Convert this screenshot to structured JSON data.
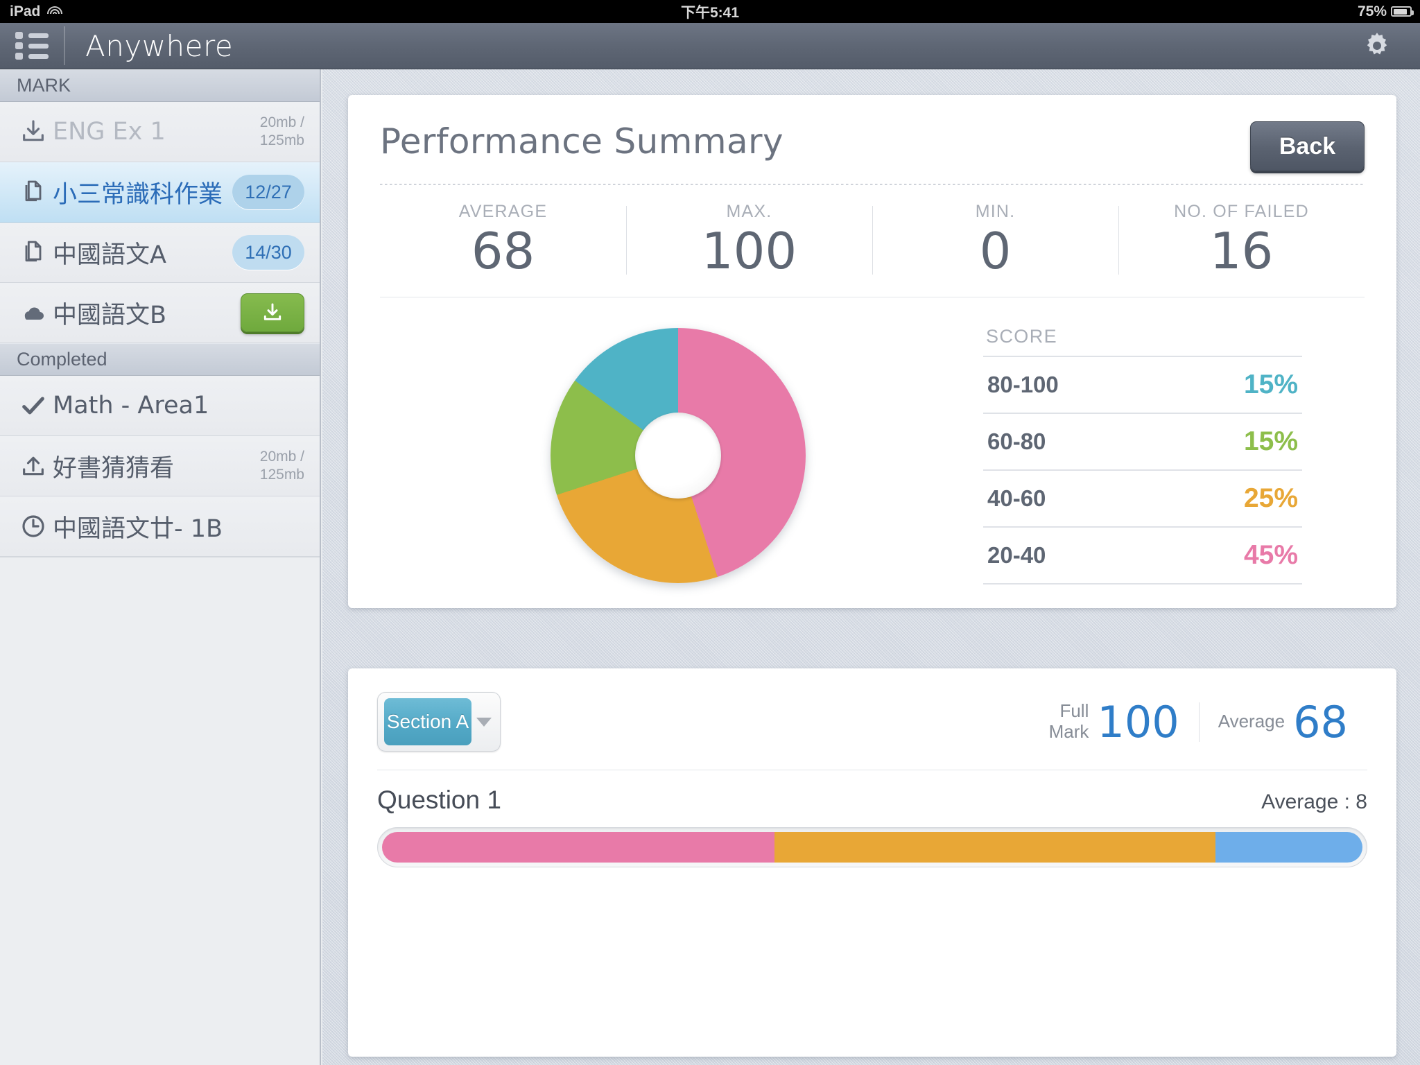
{
  "statusbar": {
    "device": "iPad",
    "wifi_icon": "wifi-icon",
    "time": "下午5:41",
    "battery_pct": "75%",
    "battery_icon": "battery-icon"
  },
  "navbar": {
    "menu_icon": "list-menu-icon",
    "title": "Anywhere",
    "settings_icon": "gear-icon"
  },
  "sidebar": {
    "sections": [
      {
        "header": "MARK",
        "items": [
          {
            "icon": "download-icon",
            "label": "ENG Ex 1",
            "size": "20mb /\n125mb",
            "badge": null,
            "state": "dimmed",
            "action": null
          },
          {
            "icon": "documents-icon",
            "label": "小三常識科作業",
            "size": null,
            "badge": "12/27",
            "state": "selected",
            "action": null
          },
          {
            "icon": "documents-icon",
            "label": "中國語文A",
            "size": null,
            "badge": "14/30",
            "state": "normal",
            "action": null
          },
          {
            "icon": "cloud-icon",
            "label": "中國語文B",
            "size": null,
            "badge": null,
            "state": "normal",
            "action": "download-button"
          }
        ]
      },
      {
        "header": "Completed",
        "items": [
          {
            "icon": "check-icon",
            "label": "Math - Area1",
            "size": null,
            "badge": null,
            "state": "normal",
            "action": null
          },
          {
            "icon": "upload-icon",
            "label": "好書猜猜看",
            "size": "20mb /\n125mb",
            "badge": null,
            "state": "normal",
            "action": null
          },
          {
            "icon": "clock-icon",
            "label": "中國語文廿- 1B",
            "size": null,
            "badge": null,
            "state": "normal",
            "action": null
          }
        ]
      }
    ]
  },
  "summary": {
    "title": "Performance Summary",
    "back_label": "Back",
    "stats": [
      {
        "key": "AVERAGE",
        "value": "68"
      },
      {
        "key": "MAX.",
        "value": "100"
      },
      {
        "key": "MIN.",
        "value": "0"
      },
      {
        "key": "NO. OF FAILED",
        "value": "16"
      }
    ],
    "legend_header": "SCORE"
  },
  "section": {
    "selected_option": "Section A",
    "options": [
      "Section A"
    ],
    "caret_icon": "chevron-down-icon",
    "full_mark_label": "Full\nMark",
    "full_mark_value": "100",
    "average_label": "Average",
    "average_value": "68",
    "question_title": "Question 1",
    "question_average": "Average : 8"
  },
  "chart_data": {
    "type": "pie",
    "title": "Score distribution",
    "subtitle": "",
    "legend_position": "right",
    "legend_header": "SCORE",
    "categories": [
      "80-100",
      "60-80",
      "40-60",
      "20-40"
    ],
    "values": [
      15,
      15,
      25,
      45
    ],
    "value_labels": [
      "15%",
      "15%",
      "25%",
      "45%"
    ],
    "colors": [
      "#4fb3c6",
      "#8dbe4b",
      "#e8a736",
      "#e87aa8"
    ],
    "donut": true,
    "inner_radius_pct": 34,
    "start_angle_deg": 0,
    "order_clockwise_from_top": [
      "20-40",
      "40-60",
      "60-80",
      "80-100"
    ],
    "ylabel": "",
    "xlabel": ""
  },
  "question_bar": {
    "type": "bar",
    "title": "Question 1",
    "segments": [
      {
        "name": "pink",
        "pct": 40,
        "color": "#e87aa8"
      },
      {
        "name": "orange",
        "pct": 45,
        "color": "#e8a736"
      },
      {
        "name": "blue",
        "pct": 15,
        "color": "#6eaeea"
      }
    ]
  },
  "colors": {
    "accent_blue": "#2f7dc8",
    "teal": "#4fb3c6",
    "green": "#8dbe4b",
    "orange": "#e8a736",
    "pink": "#e87aa8",
    "bar_blue": "#6eaeea",
    "navbar": "#5e6674",
    "download_green": "#6fa93d"
  }
}
